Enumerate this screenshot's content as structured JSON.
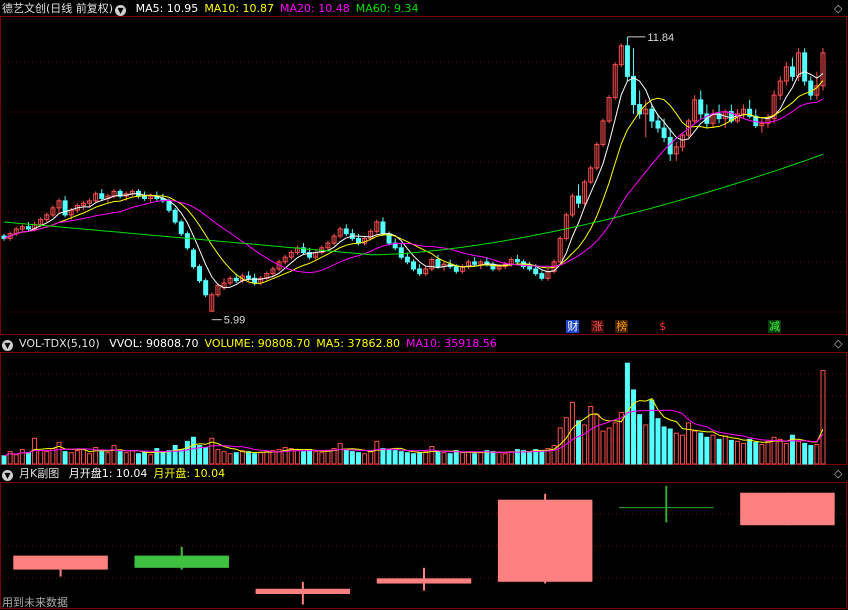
{
  "main_panel": {
    "stock_name": "德艺文创(日线 前复权)",
    "ma_labels": [
      {
        "text": "MA5: 10.95",
        "color": "#ffffff"
      },
      {
        "text": "MA10: 10.87",
        "color": "#ffff00"
      },
      {
        "text": "MA20: 10.48",
        "color": "#ff00ff"
      },
      {
        "text": "MA60: 9.34",
        "color": "#00e000"
      }
    ],
    "high_label": "11.84",
    "low_label": "5.99",
    "event_tags": [
      {
        "text": "财",
        "color": "#ffffff",
        "bg": "#1e46c8"
      },
      {
        "text": "涨",
        "color": "#ff5050",
        "bg": "#3c0a0a"
      },
      {
        "text": "榜",
        "color": "#ff9a00",
        "bg": "#3c2000"
      },
      {
        "text": "$",
        "color": "#ff3030",
        "bg": "#000000"
      },
      {
        "text": "减",
        "color": "#40ff40",
        "bg": "#0a3c0a"
      }
    ]
  },
  "volume_panel": {
    "indicator": "VOL-TDX(5,10)",
    "labels": [
      {
        "text": "VVOL: 90808.70",
        "color": "#ffffff"
      },
      {
        "text": "VOLUME: 90808.70",
        "color": "#ffff00"
      },
      {
        "text": "MA5: 37862.80",
        "color": "#ffff00"
      },
      {
        "text": "MA10: 35918.56",
        "color": "#ff00ff"
      }
    ]
  },
  "monthly_panel": {
    "indicator": "月K副图",
    "labels": [
      {
        "text": "月开盘1: 10.04",
        "color": "#ffffff"
      },
      {
        "text": "月开盘: 10.04",
        "color": "#ffff00"
      }
    ]
  },
  "footer_note": "用到未来数据",
  "corner_icons": [
    "diamond-icon",
    "diamond-icon",
    "diamond-icon"
  ],
  "colors": {
    "up": "#ff5050",
    "down": "#54ffff",
    "grid": "#7a0000",
    "ma5": "#ffffff",
    "ma10": "#ffff00",
    "ma20": "#ff00ff",
    "ma60": "#00e000"
  },
  "chart_data": [
    {
      "type": "candlestick",
      "title": "德艺文创(日线 前复权)",
      "ylim": [
        5.6,
        12.2
      ],
      "annotations": [
        {
          "text": "11.84",
          "note": "period high"
        },
        {
          "text": "5.99",
          "note": "period low"
        }
      ],
      "ohlc": [
        [
          7.6,
          7.65,
          7.5,
          7.55
        ],
        [
          7.55,
          7.7,
          7.5,
          7.65
        ],
        [
          7.65,
          7.8,
          7.6,
          7.75
        ],
        [
          7.75,
          7.85,
          7.7,
          7.8
        ],
        [
          7.8,
          7.9,
          7.7,
          7.75
        ],
        [
          7.75,
          7.9,
          7.7,
          7.85
        ],
        [
          7.85,
          8.0,
          7.8,
          7.95
        ],
        [
          7.95,
          8.1,
          7.9,
          8.05
        ],
        [
          8.05,
          8.25,
          8.0,
          8.2
        ],
        [
          8.2,
          8.4,
          8.1,
          8.35
        ],
        [
          8.35,
          8.45,
          8.0,
          8.05
        ],
        [
          8.05,
          8.2,
          7.95,
          8.15
        ],
        [
          8.15,
          8.3,
          8.1,
          8.25
        ],
        [
          8.25,
          8.35,
          8.15,
          8.3
        ],
        [
          8.3,
          8.4,
          8.2,
          8.35
        ],
        [
          8.35,
          8.55,
          8.3,
          8.5
        ],
        [
          8.5,
          8.6,
          8.35,
          8.4
        ],
        [
          8.4,
          8.5,
          8.3,
          8.45
        ],
        [
          8.45,
          8.6,
          8.4,
          8.55
        ],
        [
          8.55,
          8.6,
          8.4,
          8.45
        ],
        [
          8.45,
          8.55,
          8.35,
          8.5
        ],
        [
          8.5,
          8.6,
          8.45,
          8.55
        ],
        [
          8.55,
          8.6,
          8.4,
          8.45
        ],
        [
          8.45,
          8.55,
          8.35,
          8.4
        ],
        [
          8.4,
          8.5,
          8.3,
          8.45
        ],
        [
          8.45,
          8.55,
          8.35,
          8.4
        ],
        [
          8.4,
          8.5,
          8.3,
          8.35
        ],
        [
          8.35,
          8.4,
          8.1,
          8.15
        ],
        [
          8.15,
          8.2,
          7.85,
          7.9
        ],
        [
          7.9,
          7.95,
          7.6,
          7.65
        ],
        [
          7.65,
          7.7,
          7.3,
          7.35
        ],
        [
          7.3,
          7.35,
          6.9,
          6.95
        ],
        [
          6.95,
          7.0,
          6.6,
          6.65
        ],
        [
          6.65,
          6.7,
          6.3,
          6.35
        ],
        [
          6.0,
          6.4,
          5.99,
          6.35
        ],
        [
          6.35,
          6.6,
          6.3,
          6.55
        ],
        [
          6.5,
          6.7,
          6.45,
          6.6
        ],
        [
          6.6,
          6.75,
          6.55,
          6.7
        ],
        [
          6.7,
          6.8,
          6.6,
          6.65
        ],
        [
          6.65,
          6.8,
          6.6,
          6.75
        ],
        [
          6.75,
          6.85,
          6.65,
          6.7
        ],
        [
          6.7,
          6.8,
          6.55,
          6.6
        ],
        [
          6.6,
          6.75,
          6.55,
          6.7
        ],
        [
          6.7,
          6.85,
          6.65,
          6.8
        ],
        [
          6.8,
          6.95,
          6.75,
          6.9
        ],
        [
          6.9,
          7.1,
          6.85,
          7.05
        ],
        [
          7.05,
          7.2,
          7.0,
          7.15
        ],
        [
          7.15,
          7.3,
          7.1,
          7.25
        ],
        [
          7.25,
          7.4,
          7.2,
          7.35
        ],
        [
          7.35,
          7.45,
          7.2,
          7.25
        ],
        [
          7.25,
          7.35,
          7.1,
          7.15
        ],
        [
          7.15,
          7.3,
          7.1,
          7.25
        ],
        [
          7.25,
          7.4,
          7.2,
          7.35
        ],
        [
          7.35,
          7.5,
          7.3,
          7.45
        ],
        [
          7.45,
          7.65,
          7.4,
          7.6
        ],
        [
          7.6,
          7.8,
          7.55,
          7.75
        ],
        [
          7.75,
          7.85,
          7.6,
          7.65
        ],
        [
          7.65,
          7.75,
          7.5,
          7.55
        ],
        [
          7.55,
          7.65,
          7.4,
          7.45
        ],
        [
          7.45,
          7.6,
          7.4,
          7.55
        ],
        [
          7.55,
          7.75,
          7.5,
          7.7
        ],
        [
          7.7,
          7.95,
          7.65,
          7.9
        ],
        [
          7.9,
          8.0,
          7.6,
          7.65
        ],
        [
          7.65,
          7.7,
          7.4,
          7.45
        ],
        [
          7.45,
          7.55,
          7.3,
          7.35
        ],
        [
          7.35,
          7.45,
          7.1,
          7.15
        ],
        [
          7.15,
          7.25,
          7.0,
          7.05
        ],
        [
          7.05,
          7.1,
          6.85,
          6.9
        ],
        [
          6.9,
          7.0,
          6.75,
          6.8
        ],
        [
          6.8,
          6.95,
          6.75,
          6.9
        ],
        [
          6.9,
          7.15,
          6.85,
          7.1
        ],
        [
          7.1,
          7.2,
          6.9,
          6.95
        ],
        [
          6.95,
          7.05,
          6.85,
          7.0
        ],
        [
          7.0,
          7.1,
          6.9,
          6.95
        ],
        [
          6.95,
          7.0,
          6.8,
          6.85
        ],
        [
          6.85,
          7.0,
          6.8,
          6.95
        ],
        [
          6.95,
          7.1,
          6.9,
          7.05
        ],
        [
          7.05,
          7.15,
          6.95,
          7.0
        ],
        [
          7.0,
          7.1,
          6.9,
          7.05
        ],
        [
          7.05,
          7.15,
          6.95,
          7.0
        ],
        [
          7.0,
          7.05,
          6.85,
          6.9
        ],
        [
          6.9,
          7.0,
          6.85,
          6.95
        ],
        [
          6.95,
          7.05,
          6.9,
          7.0
        ],
        [
          7.0,
          7.15,
          6.95,
          7.1
        ],
        [
          7.1,
          7.2,
          7.0,
          7.05
        ],
        [
          7.05,
          7.1,
          6.9,
          6.95
        ],
        [
          6.95,
          7.05,
          6.85,
          6.9
        ],
        [
          6.9,
          7.0,
          6.75,
          6.8
        ],
        [
          6.8,
          6.85,
          6.65,
          6.7
        ],
        [
          6.7,
          6.9,
          6.65,
          6.85
        ],
        [
          6.85,
          7.1,
          6.8,
          7.05
        ],
        [
          7.05,
          7.6,
          7.0,
          7.55
        ],
        [
          7.55,
          8.1,
          7.5,
          8.05
        ],
        [
          8.05,
          8.5,
          8.0,
          8.45
        ],
        [
          8.45,
          8.7,
          8.2,
          8.3
        ],
        [
          8.3,
          8.8,
          8.25,
          8.75
        ],
        [
          8.75,
          9.1,
          8.7,
          9.05
        ],
        [
          9.05,
          9.6,
          9.0,
          9.55
        ],
        [
          9.55,
          10.1,
          9.5,
          10.05
        ],
        [
          10.05,
          10.6,
          10.0,
          10.55
        ],
        [
          10.55,
          11.3,
          10.5,
          11.25
        ],
        [
          11.25,
          11.7,
          11.2,
          11.65
        ],
        [
          11.65,
          11.84,
          10.9,
          11.0
        ],
        [
          11.0,
          11.6,
          10.2,
          10.4
        ],
        [
          10.4,
          10.7,
          10.1,
          10.2
        ],
        [
          10.2,
          10.5,
          9.7,
          10.3
        ],
        [
          10.3,
          10.4,
          9.9,
          10.05
        ],
        [
          10.05,
          10.2,
          9.8,
          9.9
        ],
        [
          9.9,
          10.1,
          9.6,
          9.7
        ],
        [
          9.7,
          9.9,
          9.2,
          9.35
        ],
        [
          9.35,
          9.6,
          9.2,
          9.5
        ],
        [
          9.5,
          9.8,
          9.4,
          9.75
        ],
        [
          9.75,
          10.1,
          9.7,
          10.05
        ],
        [
          10.05,
          10.6,
          10.0,
          10.5
        ],
        [
          10.5,
          10.7,
          10.1,
          10.2
        ],
        [
          10.2,
          10.4,
          9.9,
          10.0
        ],
        [
          10.0,
          10.3,
          9.9,
          10.2
        ],
        [
          10.2,
          10.4,
          10.0,
          10.1
        ],
        [
          10.1,
          10.3,
          9.9,
          10.25
        ],
        [
          10.25,
          10.4,
          10.0,
          10.05
        ],
        [
          10.05,
          10.3,
          10.0,
          10.2
        ],
        [
          10.2,
          10.4,
          10.1,
          10.3
        ],
        [
          10.3,
          10.5,
          10.1,
          10.15
        ],
        [
          10.15,
          10.3,
          9.9,
          9.95
        ],
        [
          9.95,
          10.1,
          9.8,
          10.0
        ],
        [
          10.0,
          10.2,
          9.9,
          10.1
        ],
        [
          10.1,
          10.7,
          10.0,
          10.6
        ],
        [
          10.6,
          11.0,
          10.5,
          10.9
        ],
        [
          10.9,
          11.3,
          10.8,
          11.2
        ],
        [
          11.2,
          11.4,
          10.9,
          11.0
        ],
        [
          11.0,
          11.6,
          10.9,
          11.5
        ],
        [
          11.5,
          11.6,
          10.8,
          10.9
        ],
        [
          10.9,
          11.0,
          10.5,
          10.6
        ],
        [
          10.6,
          11.1,
          10.5,
          10.8
        ],
        [
          10.8,
          11.6,
          10.7,
          11.5
        ]
      ],
      "ma60_trend": {
        "start": 7.9,
        "min": 7.2,
        "end": 9.34
      }
    },
    {
      "type": "bar",
      "title": "VOL-TDX(5,10)",
      "series_name": "VOLUME",
      "last_value": 90808.7,
      "ma5_last": 37862.8,
      "ma10_last": 35918.56,
      "ylim": [
        0,
        105000
      ],
      "values": [
        8000,
        12000,
        9000,
        14000,
        11000,
        25000,
        13000,
        12000,
        15000,
        21000,
        12000,
        11000,
        13000,
        14000,
        10000,
        16000,
        12000,
        11000,
        18000,
        12000,
        11000,
        13000,
        10000,
        12000,
        9000,
        15000,
        11000,
        13000,
        18000,
        14000,
        22000,
        26000,
        18000,
        16000,
        25000,
        14000,
        12000,
        10000,
        11000,
        13000,
        12000,
        10000,
        11000,
        12000,
        13000,
        14000,
        16000,
        15000,
        13000,
        12000,
        14000,
        12000,
        11000,
        13000,
        15000,
        20000,
        14000,
        12000,
        11000,
        10000,
        12000,
        22000,
        15000,
        14000,
        13000,
        12000,
        11000,
        10000,
        11000,
        12000,
        17000,
        12000,
        11000,
        10000,
        13000,
        11000,
        12000,
        10000,
        11000,
        13000,
        12000,
        11000,
        10000,
        12000,
        14000,
        13000,
        12000,
        14000,
        13000,
        15000,
        18000,
        35000,
        45000,
        60000,
        42000,
        38000,
        56000,
        48000,
        32000,
        35000,
        40000,
        50000,
        98000,
        72000,
        48000,
        38000,
        62000,
        44000,
        36000,
        34000,
        30000,
        28000,
        40000,
        32000,
        30000,
        26000,
        28000,
        24000,
        27000,
        23000,
        22000,
        20000,
        24000,
        21000,
        19000,
        22000,
        26000,
        24000,
        20000,
        28000,
        22000,
        20000,
        18000,
        19000,
        90808.7
      ]
    },
    {
      "type": "candlestick",
      "title": "月K副图",
      "ylim": [
        5.3,
        12.4
      ],
      "months": [
        {
          "open": 7.5,
          "high": 7.9,
          "close": 8.3,
          "low": 7.1,
          "dir": "up"
        },
        {
          "open": 8.3,
          "high": 8.8,
          "close": 7.6,
          "low": 7.5,
          "dir": "down"
        },
        {
          "open": 6.1,
          "high": 6.8,
          "close": 6.4,
          "low": 5.5,
          "dir": "up"
        },
        {
          "open": 6.7,
          "high": 7.6,
          "close": 7.0,
          "low": 6.3,
          "dir": "up"
        },
        {
          "open": 6.8,
          "high": 11.84,
          "close": 11.5,
          "low": 6.7,
          "dir": "up"
        },
        {
          "open": 11.0,
          "high": 12.3,
          "close": 11.05,
          "low": 10.2,
          "dir": "down"
        },
        {
          "open": 10.04,
          "high": 11.9,
          "close": 11.9,
          "low": 10.04,
          "dir": "up"
        }
      ]
    }
  ]
}
